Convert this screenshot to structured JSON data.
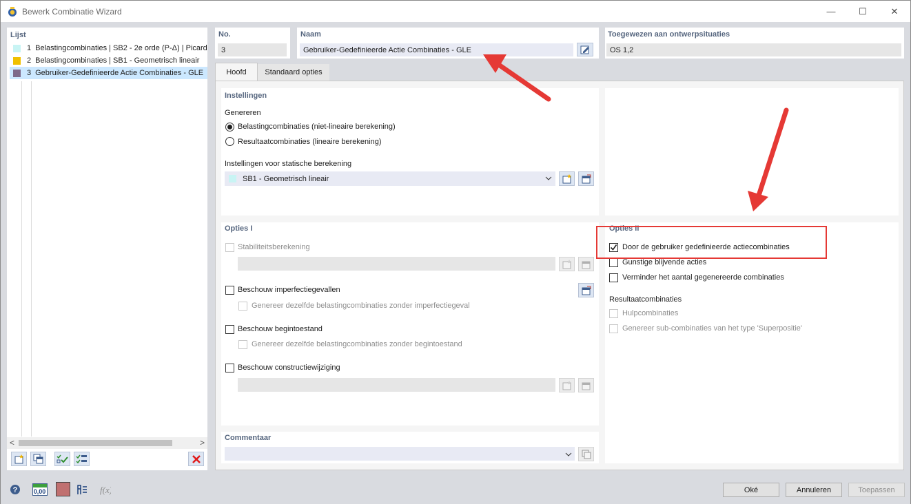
{
  "window": {
    "title": "Bewerk Combinatie Wizard",
    "minimize": "—",
    "maximize": "☐",
    "close": "✕"
  },
  "list": {
    "header": "Lijst",
    "items": [
      {
        "no": "1",
        "label": "Belastingcombinaties | SB2 - 2e orde (P-Δ) | Picard",
        "color": "#c8f4f4"
      },
      {
        "no": "2",
        "label": "Belastingcombinaties | SB1 - Geometrisch lineair",
        "color": "#f0c000"
      },
      {
        "no": "3",
        "label": "Gebruiker-Gedefinieerde Actie Combinaties - GLE",
        "color": "#7e6a8a"
      }
    ],
    "scroll_left": "<",
    "scroll_right": ">"
  },
  "header": {
    "no_label": "No.",
    "no_value": "3",
    "name_label": "Naam",
    "name_value": "Gebruiker-Gedefinieerde Actie Combinaties - GLE",
    "assigned_label": "Toegewezen aan ontwerpsituaties",
    "assigned_value": "OS 1,2"
  },
  "tabs": [
    "Hoofd",
    "Standaard opties"
  ],
  "settings": {
    "title": "Instellingen",
    "generate_label": "Genereren",
    "radio1": "Belastingcombinaties (niet-lineaire berekening)",
    "radio2": "Resultaatcombinaties (lineaire berekening)",
    "static_label": "Instellingen voor statische berekening",
    "static_value": "SB1 - Geometrisch lineair",
    "static_color": "#c8f4f4"
  },
  "options1": {
    "title": "Opties I",
    "stability": "Stabiliteitsberekening",
    "imperfection": "Beschouw imperfectiegevallen",
    "imperfection_sub": "Genereer dezelfde belastingcombinaties zonder imperfectiegeval",
    "initial": "Beschouw begintoestand",
    "initial_sub": "Genereer dezelfde belastingcombinaties zonder begintoestand",
    "modification": "Beschouw constructiewijziging"
  },
  "options2": {
    "title": "Opties II",
    "user_defined": "Door de gebruiker gedefinieerde actiecombinaties",
    "favorable": "Gunstige blijvende acties",
    "reduce": "Verminder het aantal gegenereerde combinaties",
    "result_label": "Resultaatcombinaties",
    "auxiliary": "Hulpcombinaties",
    "sub": "Genereer sub-combinaties van het type 'Superpositie'"
  },
  "comment": {
    "label": "Commentaar",
    "value": ""
  },
  "footer": {
    "ok": "Oké",
    "cancel": "Annuleren",
    "apply": "Toepassen",
    "zero_value": "0,00"
  },
  "colors": {
    "highlight": "#e53935",
    "accent_label": "#55657e",
    "selected_row": "#cce8ff"
  }
}
